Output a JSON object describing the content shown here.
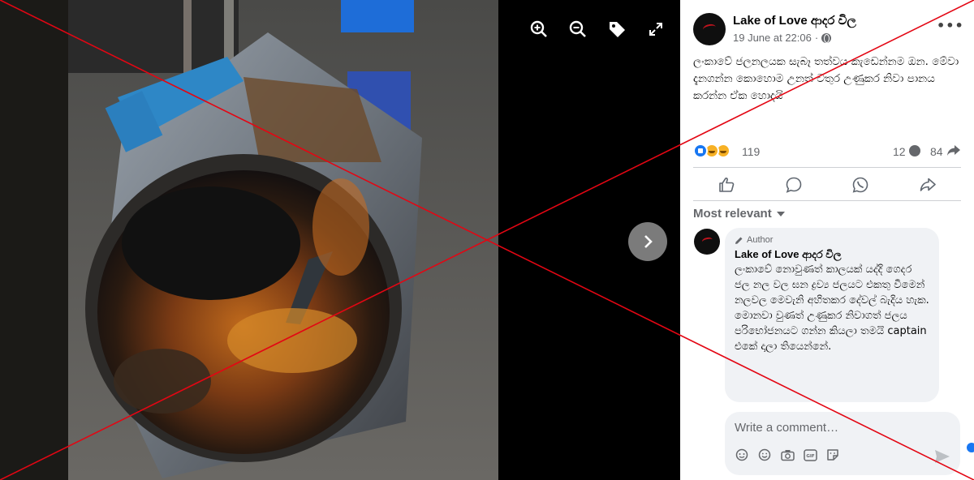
{
  "viewer": {
    "tools": [
      "zoom-in-icon",
      "zoom-out-icon",
      "tag-icon",
      "fullscreen-icon"
    ],
    "next_icon": "chevron-right-icon"
  },
  "post": {
    "page_name": "Lake of Love ආදර විල",
    "timestamp": "19 June at 22:06",
    "audience_icon": "globe-icon",
    "more_label": "•••",
    "text": "ලංකාවේ ජලනලයක සැබෑ තත්වය කැඩෙන්නම ඔන. මේවා දැනගන්න කොහොම උනත් වතුර උණුකර නිවා පානය කරන්න ඒක හොදයි",
    "reactions": {
      "types": [
        "like",
        "sad",
        "haha"
      ],
      "count": "119"
    },
    "comments_count": "12",
    "shares_count": "84",
    "actions": [
      "like-icon",
      "comment-icon",
      "whatsapp-icon",
      "share-icon"
    ]
  },
  "comments": {
    "sort_label": "Most relevant",
    "items": [
      {
        "badge": "Author",
        "author": "Lake of Love ආදර විල",
        "text": "ලංකාවේ නොවුණත් කාලයක් යද්දි ගෙදර ජල නල වල ඝන ද්‍රව්‍ය ජලයට එකතු වීමෙන් නලවල මෙවැනි අහිතකර දේවල් බැදිය හැක. මොනවා වුණත් උණුකර නිවාගත් ජලය පරිභෝජනයට ගන්න කියලා තමයි captain එකේ දාලා තියෙන්නේ."
      }
    ]
  },
  "composer": {
    "placeholder": "Write a comment…",
    "tools": [
      "sticker-icon",
      "emoji-icon",
      "camera-icon",
      "gif-icon",
      "avatar-sticker-icon"
    ],
    "send_icon": "send-icon"
  },
  "overlay": {
    "type": "red-x",
    "color": "#e30613"
  }
}
